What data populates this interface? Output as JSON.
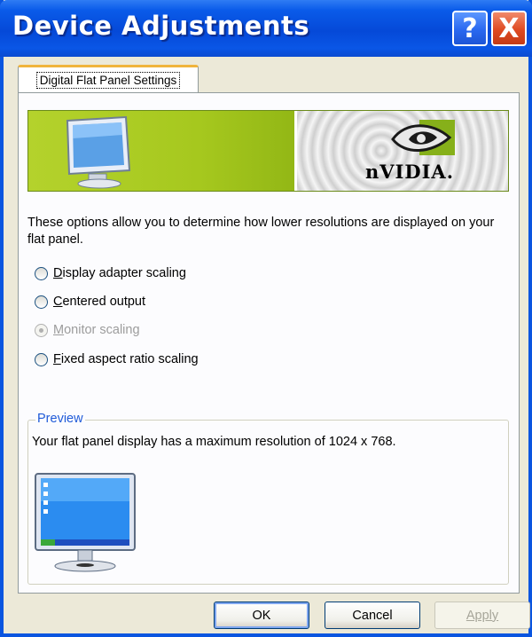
{
  "window": {
    "title": "Device Adjustments",
    "help_label": "?",
    "close_label": "X"
  },
  "tabs": [
    {
      "label": "Digital Flat Panel Settings",
      "selected": true
    }
  ],
  "banner": {
    "brand": "nVIDIA."
  },
  "description": "These options allow you to determine how lower resolutions are displayed on your flat panel.",
  "options": [
    {
      "mnemonic": "D",
      "rest": "isplay adapter scaling",
      "enabled": true,
      "selected": false
    },
    {
      "mnemonic": "C",
      "rest": "entered output",
      "enabled": true,
      "selected": false
    },
    {
      "mnemonic": "M",
      "rest": "onitor scaling",
      "enabled": false,
      "selected": true
    },
    {
      "mnemonic": "F",
      "rest": "ixed aspect ratio scaling",
      "enabled": true,
      "selected": false
    }
  ],
  "preview": {
    "legend": "Preview",
    "text": "Your flat panel display has a maximum resolution of 1024 x 768."
  },
  "buttons": {
    "ok": "OK",
    "cancel": "Cancel",
    "apply": "Apply"
  },
  "colors": {
    "title_bar": "#0549d8",
    "window_face": "#ece9d8",
    "nvidia_green": "#a6c81e",
    "preview_legend": "#1f5ad8",
    "disabled_text": "#9c9c9c"
  },
  "icons": [
    "help-icon",
    "close-icon",
    "monitor-icon",
    "nvidia-eye-icon",
    "radio-icon"
  ]
}
